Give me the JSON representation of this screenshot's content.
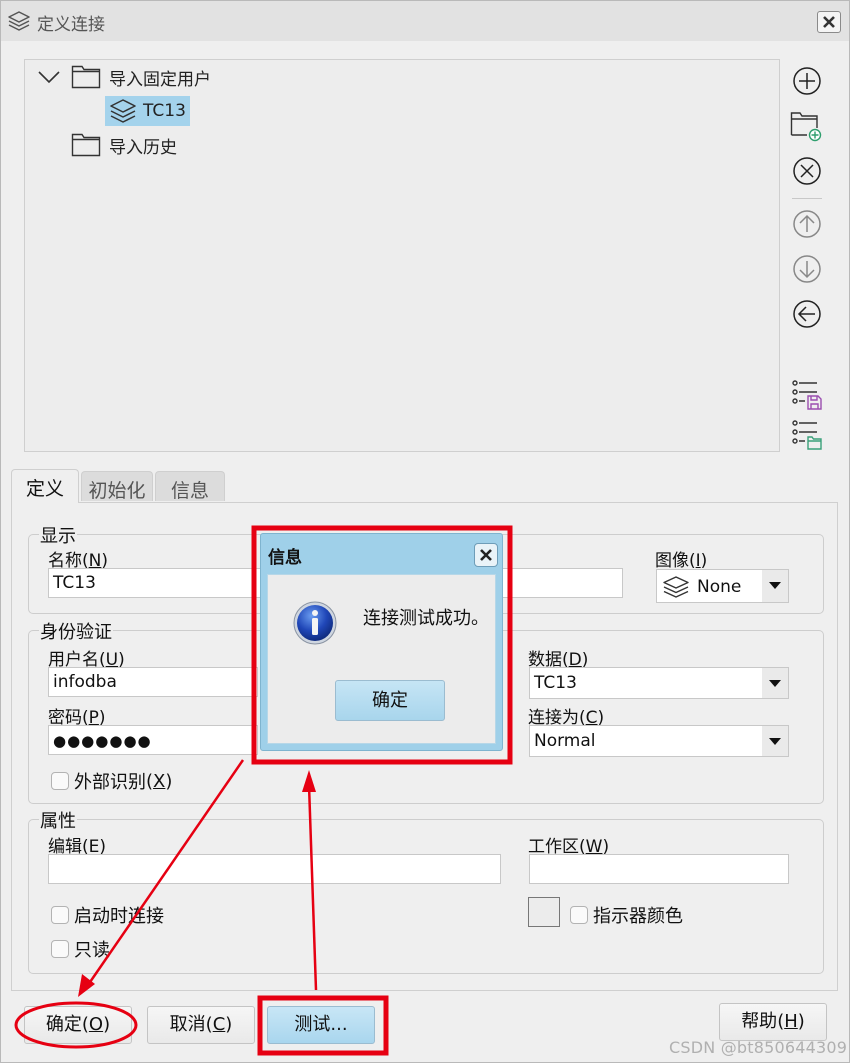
{
  "window": {
    "title": "定义连接",
    "title_icon": "layers-icon",
    "close_icon": "close-icon"
  },
  "tree": {
    "items": [
      {
        "label": "导入固定用户",
        "icon": "folder-icon",
        "expanded": true,
        "level": 0
      },
      {
        "label": "TC13",
        "icon": "layers-icon",
        "selected": true,
        "level": 1
      },
      {
        "label": "导入历史",
        "icon": "folder-icon",
        "expanded": false,
        "level": 0
      }
    ]
  },
  "side_toolbar": {
    "buttons": [
      {
        "name": "add",
        "icon": "plus-circle-icon",
        "enabled": true
      },
      {
        "name": "add-folder",
        "icon": "folder-add-icon",
        "enabled": true
      },
      {
        "name": "remove",
        "icon": "x-circle-icon",
        "enabled": true
      },
      {
        "name": "move-up",
        "icon": "arrow-up-circle-icon",
        "enabled": false
      },
      {
        "name": "move-down",
        "icon": "arrow-down-circle-icon",
        "enabled": false
      },
      {
        "name": "move-left",
        "icon": "arrow-left-circle-icon",
        "enabled": true
      },
      {
        "name": "save-list",
        "icon": "list-save-icon",
        "enabled": true
      },
      {
        "name": "open-list",
        "icon": "list-open-icon",
        "enabled": true
      }
    ]
  },
  "tabs": [
    {
      "label": "定义",
      "active": true
    },
    {
      "label": "初始化",
      "active": false
    },
    {
      "label": "信息",
      "active": false
    }
  ],
  "display_group": {
    "title": "显示",
    "name_label": "名称",
    "name_mnemonic": "N",
    "name_value": "TC13",
    "image_label": "图像",
    "image_mnemonic": "I",
    "image_value": "None"
  },
  "auth_group": {
    "title": "身份验证",
    "username_label": "用户名",
    "username_mnemonic": "U",
    "username_value": "infodba",
    "password_label": "密码",
    "password_mnemonic": "P",
    "password_value": "●●●●●●●",
    "external_label": "外部识别",
    "external_mnemonic": "X",
    "external_checked": false,
    "data_label": "数据",
    "data_mnemonic": "D",
    "data_value": "TC13",
    "connect_as_label": "连接为",
    "connect_as_mnemonic": "C",
    "connect_as_value": "Normal"
  },
  "props_group": {
    "title": "属性",
    "edit_label": "编辑",
    "edit_mnemonic": "E",
    "edit_value": "",
    "workspace_label": "工作区",
    "workspace_mnemonic": "W",
    "workspace_value": "",
    "connect_on_start_label": "启动时连接",
    "connect_on_start_checked": false,
    "readonly_label": "只读",
    "readonly_checked": false,
    "indicator_color_label": "指示器颜色",
    "indicator_color_checked": false
  },
  "buttons": {
    "ok_label": "确定",
    "ok_mnemonic": "O",
    "cancel_label": "取消",
    "cancel_mnemonic": "C",
    "test_label": "测试...",
    "help_label": "帮助",
    "help_mnemonic": "H"
  },
  "message_dialog": {
    "title": "信息",
    "message": "连接测试成功。",
    "icon": "info-icon",
    "ok_label": "确定"
  },
  "annotations": {
    "color": "#e60012"
  },
  "watermark": "CSDN @bt850644309"
}
